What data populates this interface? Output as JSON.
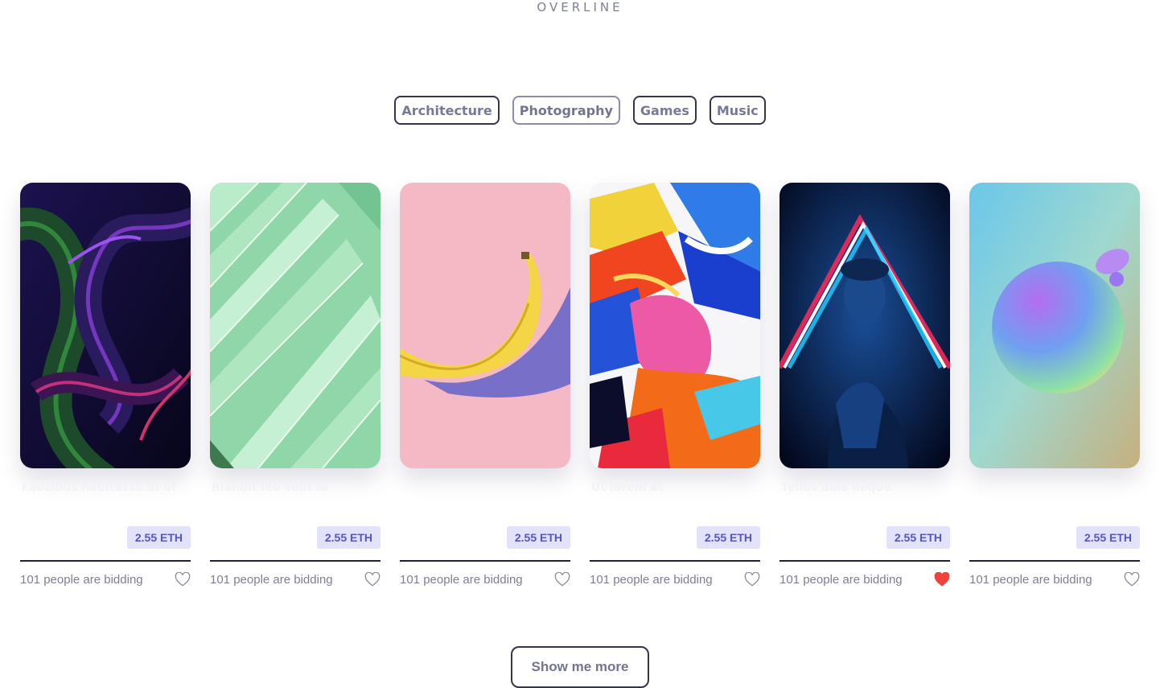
{
  "overline": "OVERLINE",
  "filters": [
    {
      "label": "Architecture",
      "active": false
    },
    {
      "label": "Photography",
      "active": true
    },
    {
      "label": "Games",
      "active": false
    },
    {
      "label": "Music",
      "active": false
    }
  ],
  "cards": [
    {
      "title": "Faucibus habitasse at ol",
      "price": "2.55 ETH",
      "bidding": "101 people are bidding",
      "liked": false,
      "image": "dark-green-purple-snakes"
    },
    {
      "title": "Blandit leo velit id",
      "price": "2.55 ETH",
      "bidding": "101 people are bidding",
      "liked": false,
      "image": "mint-green-palm-leaf"
    },
    {
      "title": "",
      "price": "2.55 ETH",
      "bidding": "101 people are bidding",
      "liked": false,
      "image": "banana-on-pink"
    },
    {
      "title": "Ut lorem at",
      "price": "2.55 ETH",
      "bidding": "101 people are bidding",
      "liked": false,
      "image": "colorful-abstract-paint"
    },
    {
      "title": "Tellus duis neque",
      "price": "2.55 ETH",
      "bidding": "101 people are bidding",
      "liked": true,
      "image": "neon-triangle-portrait"
    },
    {
      "title": "",
      "price": "2.55 ETH",
      "bidding": "101 people are bidding",
      "liked": false,
      "image": "gradient-sphere"
    }
  ],
  "show_more": "Show me more",
  "colors": {
    "accent": "#5756bf",
    "price_bg": "#e3e2fb",
    "like_active": "#f0413a",
    "border": "#33354a"
  }
}
